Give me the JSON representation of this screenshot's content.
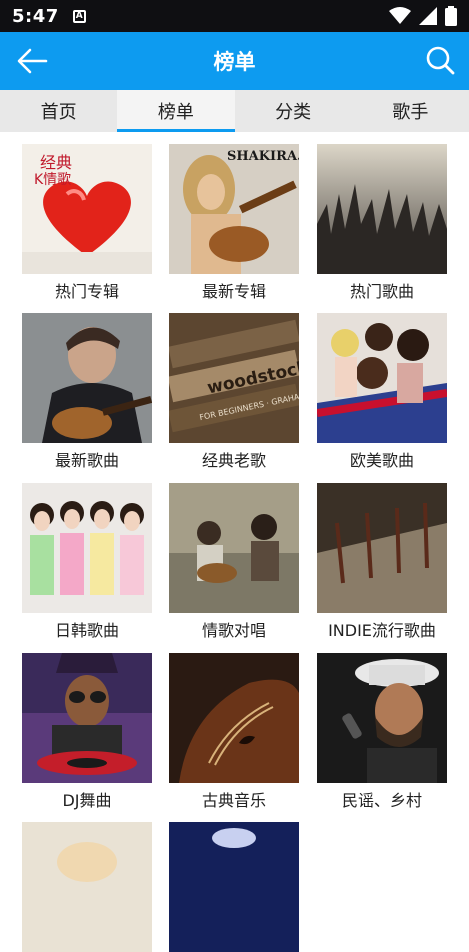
{
  "status": {
    "time": "5:47",
    "notification_glyph": "A"
  },
  "app_bar": {
    "title": "榜单"
  },
  "tabs": [
    {
      "label": "首页",
      "active": false
    },
    {
      "label": "榜单",
      "active": true
    },
    {
      "label": "分类",
      "active": false
    },
    {
      "label": "歌手",
      "active": false
    }
  ],
  "tiles": [
    {
      "label": "热门专辑",
      "cover_text_1": "经典",
      "cover_text_2": "K情歌"
    },
    {
      "label": "最新专辑",
      "cover_text_1": "SHAKIRA."
    },
    {
      "label": "热门歌曲"
    },
    {
      "label": "最新歌曲"
    },
    {
      "label": "经典老歌",
      "cover_text_1": "woodstock",
      "cover_text_2": "FOR BEGINNERS · GRAHAM"
    },
    {
      "label": "欧美歌曲"
    },
    {
      "label": "日韩歌曲"
    },
    {
      "label": "情歌对唱"
    },
    {
      "label": "INDIE流行歌曲"
    },
    {
      "label": "DJ舞曲"
    },
    {
      "label": "古典音乐"
    },
    {
      "label": "民谣、乡村"
    }
  ],
  "colors": {
    "accent": "#0d9bf0",
    "tab_bg": "#e8e8e8"
  }
}
